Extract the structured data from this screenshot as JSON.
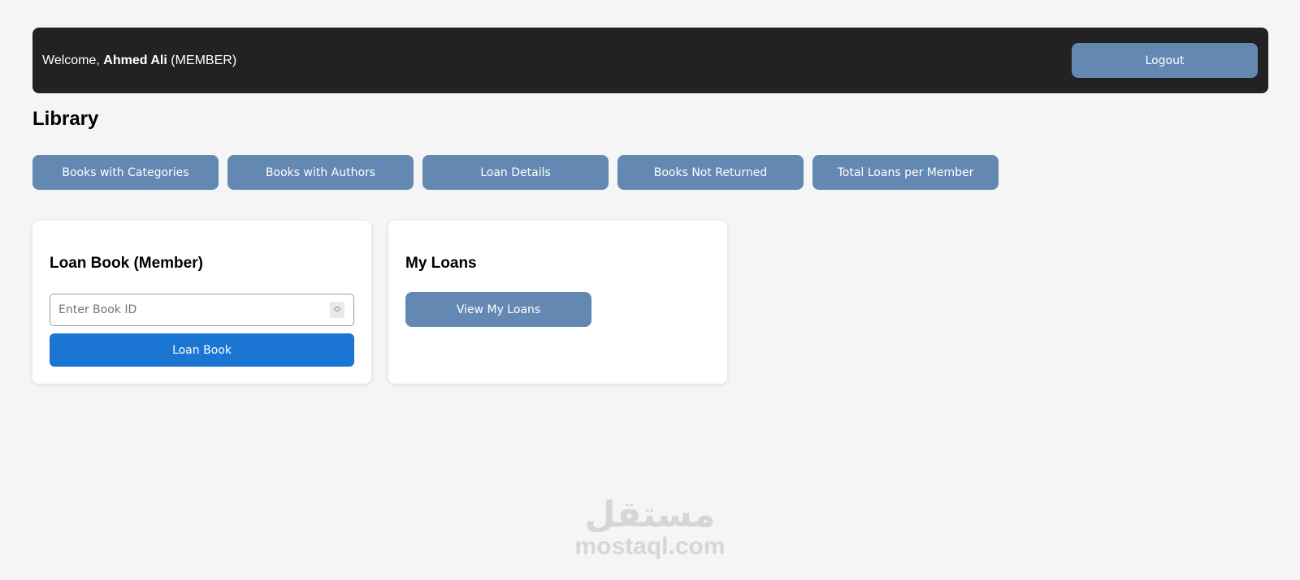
{
  "header": {
    "welcome_prefix": "Welcome, ",
    "user_name": "Ahmed Ali",
    "role": " (MEMBER)",
    "logout_label": "Logout"
  },
  "page": {
    "title": "Library"
  },
  "nav": {
    "items": [
      {
        "label": "Books with Categories"
      },
      {
        "label": "Books with Authors"
      },
      {
        "label": "Loan Details"
      },
      {
        "label": "Books Not Returned"
      },
      {
        "label": "Total Loans per Member"
      }
    ]
  },
  "loan_card": {
    "title": "Loan Book (Member)",
    "book_id_placeholder": "Enter Book ID",
    "book_id_value": "",
    "submit_label": "Loan Book"
  },
  "my_loans_card": {
    "title": "My Loans",
    "view_label": "View My Loans"
  },
  "watermark": {
    "arabic": "مستقل",
    "latin": "mostaql.com"
  },
  "colors": {
    "background": "#f5f5f5",
    "header_bg": "#222222",
    "steel_button": "#6389b3",
    "primary_button": "#1a76d2",
    "card_bg": "#ffffff"
  }
}
